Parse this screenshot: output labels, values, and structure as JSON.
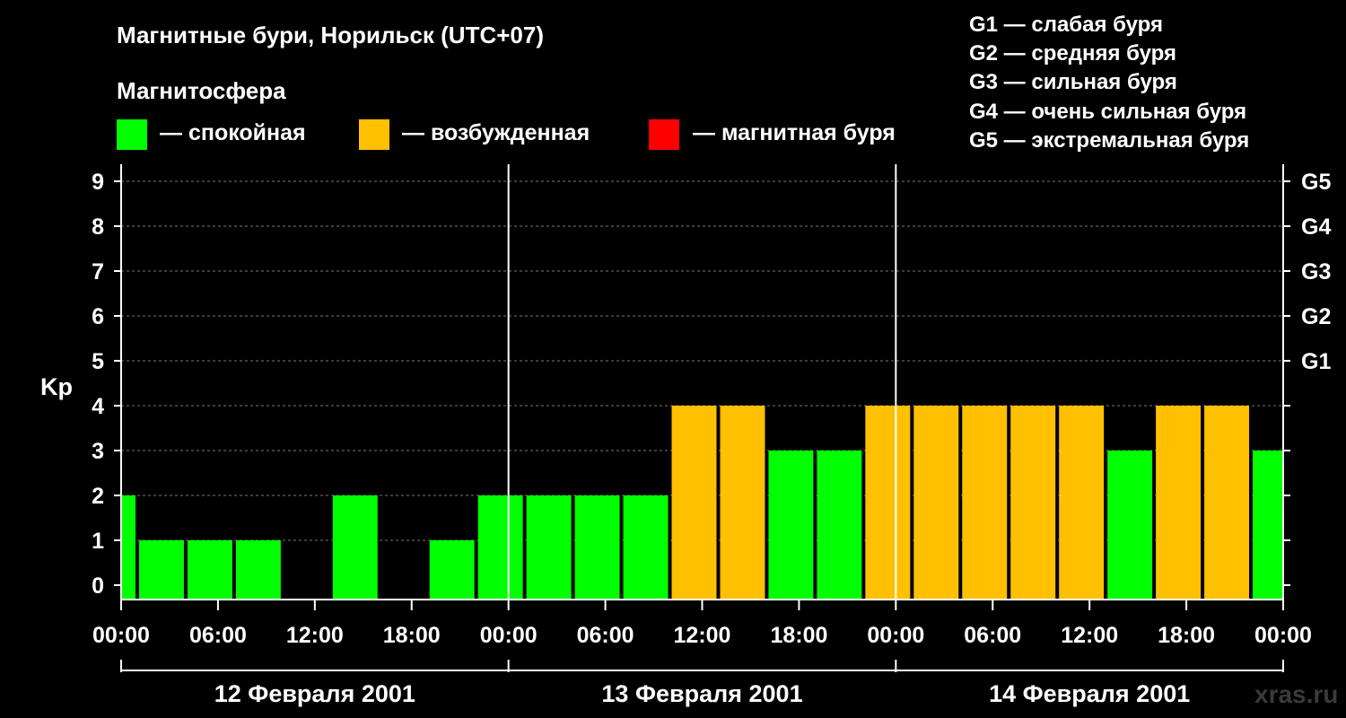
{
  "header": {
    "title": "Магнитные бури, Норильск (UTC+07)",
    "subtitle": "Магнитосфера"
  },
  "legend": {
    "items": [
      {
        "label": "— спокойная",
        "color": "#00ff00"
      },
      {
        "label": "— возбужденная",
        "color": "#ffc000"
      },
      {
        "label": "— магнитная буря",
        "color": "#ff0000"
      }
    ]
  },
  "storm_levels": [
    "G1 — слабая буря",
    "G2 — средняя буря",
    "G3 — сильная буря",
    "G4 — очень сильная буря",
    "G5 — экстремальная буря"
  ],
  "watermark": "xras.ru",
  "chart_data": {
    "type": "bar",
    "title": "Магнитные бури, Норильск (UTC+07)",
    "ylabel": "Kp",
    "ylim": [
      0,
      9
    ],
    "yticks": [
      "0",
      "1",
      "2",
      "3",
      "4",
      "5",
      "6",
      "7",
      "8",
      "9"
    ],
    "right_ticks": [
      {
        "y": 5,
        "label": "G1"
      },
      {
        "y": 6,
        "label": "G2"
      },
      {
        "y": 7,
        "label": "G3"
      },
      {
        "y": 8,
        "label": "G4"
      },
      {
        "y": 9,
        "label": "G5"
      }
    ],
    "xlim_hours": [
      0,
      72
    ],
    "first_bar_start_hour": -2,
    "bar_width_hours": 3,
    "xtick_labels": [
      "00:00",
      "06:00",
      "12:00",
      "18:00",
      "00:00",
      "06:00",
      "12:00",
      "18:00",
      "00:00",
      "06:00",
      "12:00",
      "18:00",
      "00:00"
    ],
    "day_labels": [
      "12 Февраля 2001",
      "13 Февраля 2001",
      "14 Февраля 2001"
    ],
    "values": [
      2,
      1,
      1,
      1,
      0,
      2,
      0,
      1,
      2,
      2,
      2,
      2,
      4,
      4,
      3,
      3,
      4,
      4,
      4,
      4,
      4,
      3,
      4,
      4,
      3
    ],
    "colors": {
      "quiet": "#00ff00",
      "active": "#ffc000",
      "storm": "#ff0000"
    },
    "grid": true,
    "legend_position": "top"
  }
}
